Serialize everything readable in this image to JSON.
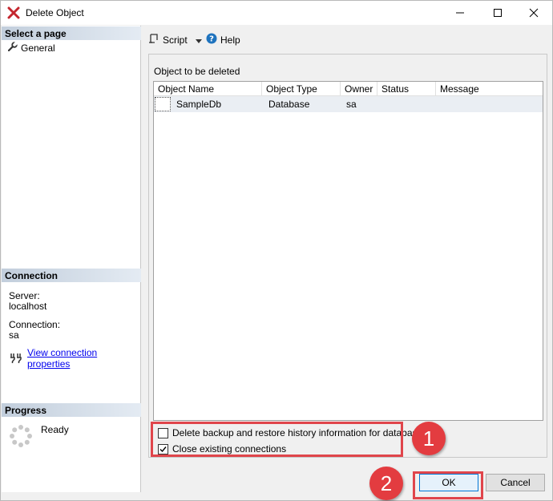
{
  "window": {
    "title": "Delete Object",
    "icon": "red-x-icon"
  },
  "sidebar": {
    "select_page_header": "Select a page",
    "pages": [
      {
        "label": "General",
        "icon": "wrench-icon"
      }
    ],
    "connection_header": "Connection",
    "server_label": "Server:",
    "server_value": "localhost",
    "connection_label": "Connection:",
    "connection_value": "sa",
    "view_properties_link": "View connection properties",
    "progress_header": "Progress",
    "progress_status": "Ready"
  },
  "toolbar": {
    "script_label": "Script",
    "help_label": "Help"
  },
  "main": {
    "section_label": "Object to be deleted",
    "columns": [
      "Object Name",
      "Object Type",
      "Owner",
      "Status",
      "Message"
    ],
    "rows": [
      {
        "name": "SampleDb",
        "type": "Database",
        "owner": "sa",
        "status": "",
        "message": ""
      }
    ]
  },
  "options": {
    "delete_backup_label": "Delete backup and restore history information for databases",
    "delete_backup_checked": false,
    "close_connections_label": "Close existing connections",
    "close_connections_checked": true
  },
  "annotations": {
    "badge_1": "1",
    "badge_2": "2",
    "color": "#e33c40"
  },
  "buttons": {
    "ok_label": "OK",
    "cancel_label": "Cancel"
  }
}
